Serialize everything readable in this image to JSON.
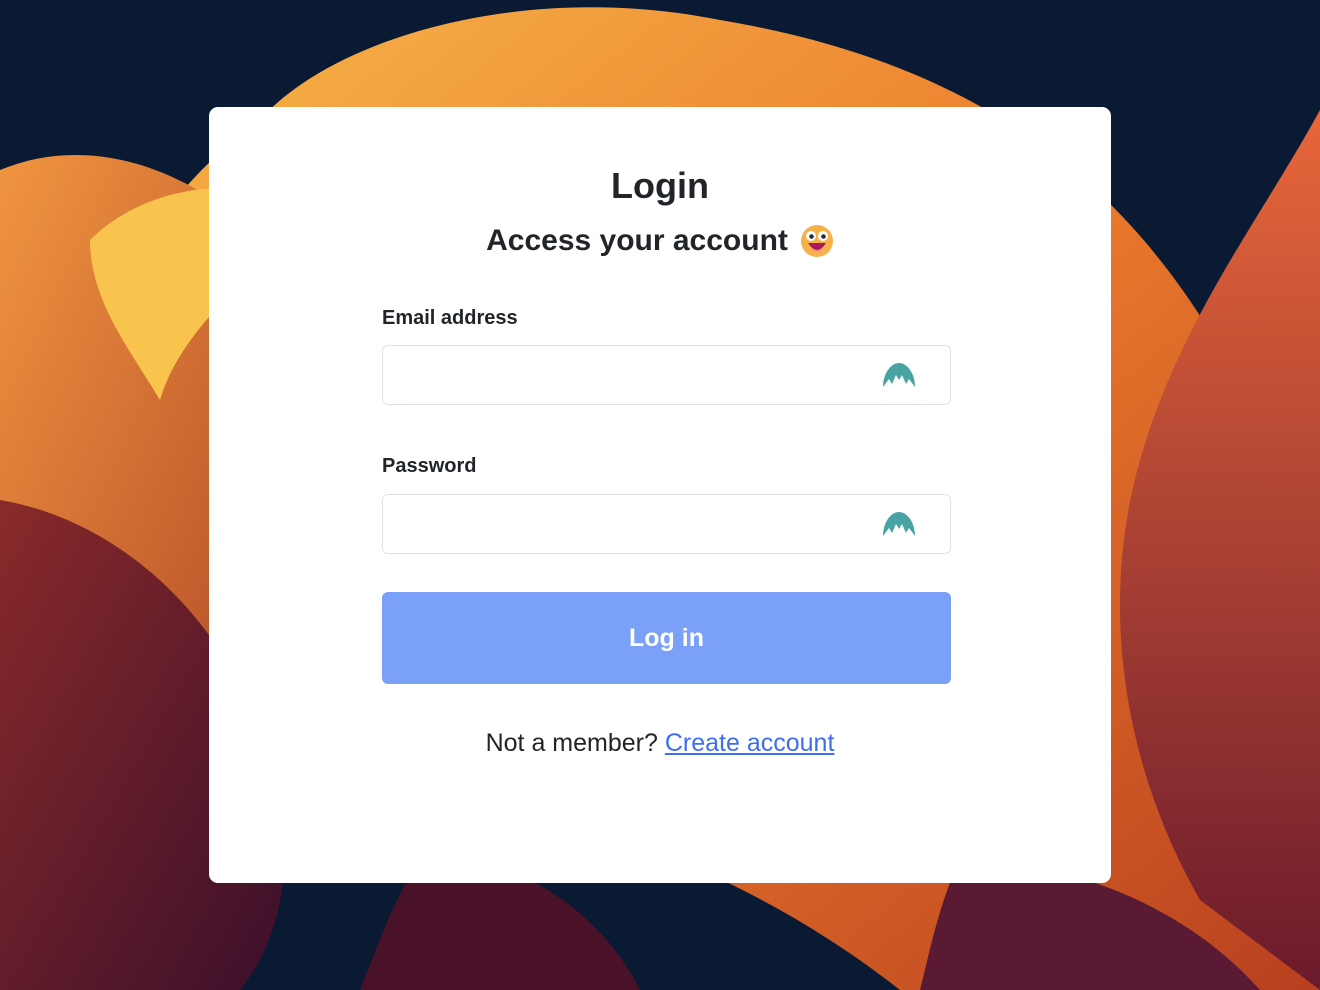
{
  "login": {
    "title": "Login",
    "subtitle": "Access your account",
    "subtitle_emoji": "grinning-face-emoji",
    "email_label": "Email address",
    "email_value": "",
    "email_placeholder": "",
    "password_label": "Password",
    "password_value": "",
    "password_placeholder": "",
    "field_icon": "nordpass-autofill-icon",
    "submit_label": "Log in",
    "footer_text": "Not a member?",
    "footer_link": "Create account"
  },
  "colors": {
    "button": "#7aa1f7",
    "link": "#3d6df2",
    "field_icon": "#4aa3a3",
    "background_dark": "#0b1a33",
    "background_orange": "#e8742e"
  }
}
